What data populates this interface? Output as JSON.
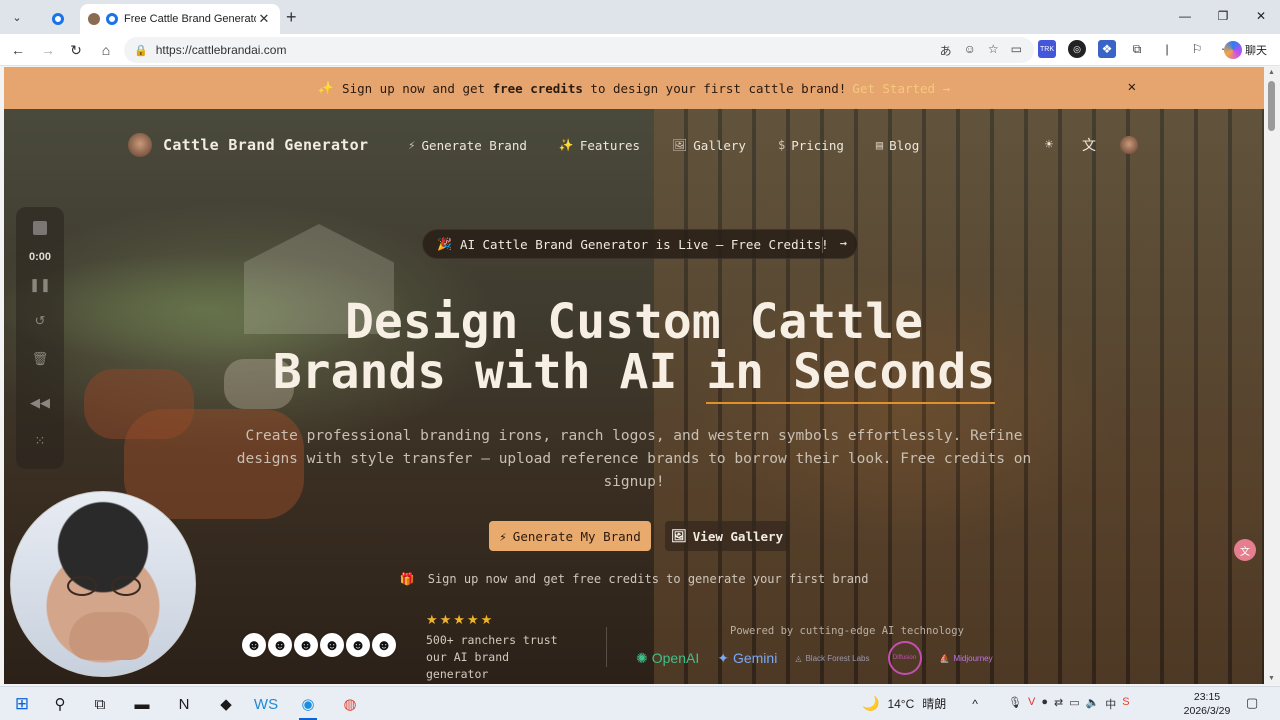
{
  "browser": {
    "active_tab_title": "Free Cattle Brand Generator |",
    "url": "https://cattlebrandai.com",
    "copilot_label": "聊天"
  },
  "banner": {
    "prefix": "Sign up now and get",
    "bold": "free credits",
    "suffix": "to design your first cattle brand!",
    "cta": "Get Started →"
  },
  "nav": {
    "brand": "Cattle Brand Generator",
    "items": [
      {
        "label": "Generate Brand",
        "icon": "⚡"
      },
      {
        "label": "Features",
        "icon": "✨"
      },
      {
        "label": "Gallery",
        "icon": "🖼"
      },
      {
        "label": "Pricing",
        "icon": "$"
      },
      {
        "label": "Blog",
        "icon": "▤"
      }
    ]
  },
  "hero": {
    "pill": "AI Cattle Brand Generator is Live – Free Credits!",
    "title_line1": "Design Custom Cattle",
    "title_line2_prefix": "Brands with AI",
    "title_line2_accent": "in Seconds",
    "subtitle": "Create professional branding irons, ranch logos, and western symbols effortlessly. Refine designs with style transfer – upload reference brands to borrow their look. Free credits on signup!",
    "primary_button": "Generate My Brand",
    "secondary_button": "View Gallery",
    "signup_note": "Sign up now and get free credits to generate your first brand",
    "rating_stars": 5,
    "trust_text": "500+ ranchers trust our AI brand generator",
    "powered_by": "Powered by cutting-edge AI technology",
    "partners": [
      "OpenAI",
      "Gemini",
      "Black Forest Labs",
      "Diffusion",
      "Midjourney"
    ]
  },
  "recorder": {
    "time": "0:00"
  },
  "taskbar": {
    "weather": "14°C",
    "weather_text": "晴朗",
    "ime": "中",
    "time": "23:15",
    "date": "2026/3/29"
  },
  "colors": {
    "banner": "#e6a56f",
    "accent": "#e2912a",
    "primary_button": "#e9aa6e"
  }
}
